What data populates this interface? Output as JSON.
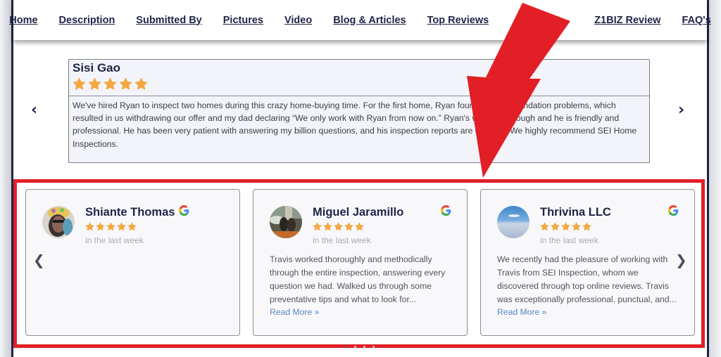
{
  "nav": {
    "items": [
      {
        "label": "Home"
      },
      {
        "label": "Description"
      },
      {
        "label": "Submitted By"
      },
      {
        "label": "Pictures"
      },
      {
        "label": "Video"
      },
      {
        "label": "Blog & Articles"
      },
      {
        "label": "Top Reviews"
      },
      {
        "label": ""
      },
      {
        "label": "Z1BIZ Review"
      },
      {
        "label": "FAQ's"
      }
    ]
  },
  "featured_review": {
    "name": "Sisi Gao",
    "rating": 5,
    "text": "We've hired Ryan to inspect two homes during this crazy home-buying time. For the first home, Ryan found serious foundation problems, which resulted in us withdrawing our offer and my dad declaring “We only work with Ryan from now on.” Ryan's work is thorough and he is friendly and professional. He has been very patient with answering my billion questions, and his inspection reports are detailed. We highly recommend SEI Home Inspections.",
    "prev_icon": "chevron-left",
    "next_icon": "chevron-right"
  },
  "google_reviews": {
    "prev_icon": "chevron-left",
    "next_icon": "chevron-right",
    "read_more_label": "Read More »",
    "colors": {
      "star": "#f5a742",
      "highlight": "#e21f26",
      "link": "#5a86c8"
    },
    "cards": [
      {
        "name": "Shiante Thomas",
        "rating": 5,
        "time": "in the last week",
        "text": "",
        "has_read_more": false,
        "source_icon": "google-g"
      },
      {
        "name": "Miguel Jaramillo",
        "rating": 5,
        "time": "in the last week",
        "text": "Travis worked thoroughly and methodically through the entire inspection, answering every question we had. Walked us through some preventative tips and what to look for...",
        "has_read_more": true,
        "source_icon": "google-g"
      },
      {
        "name": "Thrivina LLC",
        "rating": 5,
        "time": "in the last week",
        "text": "We recently had the pleasure of working with Travis from SEI Inspection, whom we discovered through top online reviews. Travis was exceptionally professional, punctual, and...",
        "has_read_more": true,
        "source_icon": "google-g"
      }
    ]
  },
  "annotation": {
    "type": "red-arrow",
    "color": "#e21f26"
  }
}
